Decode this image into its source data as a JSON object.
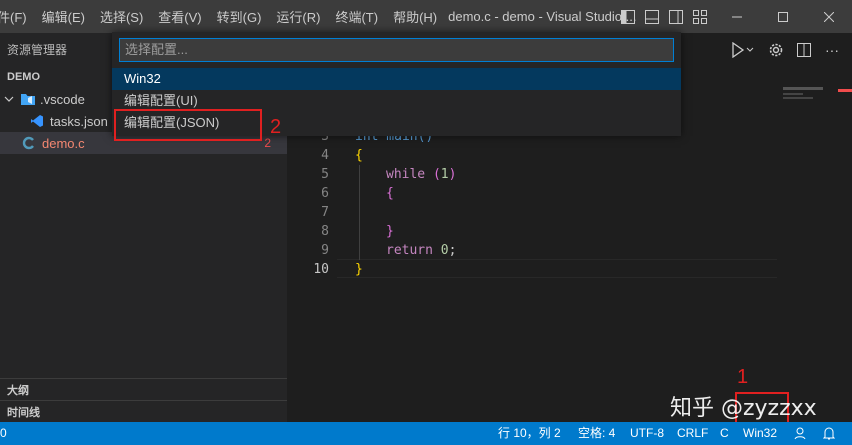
{
  "titlebar": {
    "menus": [
      "件(F)",
      "编辑(E)",
      "选择(S)",
      "查看(V)",
      "转到(G)",
      "运行(R)",
      "终端(T)",
      "帮助(H)"
    ],
    "title": "demo.c - demo - Visual Studio ...",
    "controls": [
      "minimize-icon",
      "maximize-icon",
      "close-icon"
    ]
  },
  "sidebar": {
    "header": "资源管理器",
    "section": "DEMO",
    "items": [
      {
        "label": ".vscode",
        "icon": "folder-vscode-icon"
      },
      {
        "label": "tasks.json",
        "icon": "vscode-json-icon"
      },
      {
        "label": "demo.c",
        "icon": "c-file-icon",
        "badge": "2"
      }
    ],
    "panels": [
      "大纲",
      "时间线"
    ]
  },
  "quickpick": {
    "placeholder": "选择配置...",
    "items": [
      "Win32",
      "编辑配置(UI)",
      "编辑配置(JSON)"
    ]
  },
  "editor": {
    "lines": [
      {
        "n": "3",
        "text": "int main()"
      },
      {
        "n": "4",
        "text": "{"
      },
      {
        "n": "5",
        "text": "while (1)"
      },
      {
        "n": "6",
        "text": "{"
      },
      {
        "n": "7",
        "text": ""
      },
      {
        "n": "8",
        "text": "}"
      },
      {
        "n": "9",
        "text": "return 0;"
      },
      {
        "n": "10",
        "text": "}"
      }
    ]
  },
  "annotations": {
    "one": "1",
    "two": "2"
  },
  "statusbar": {
    "left": "0",
    "position": "行 10，列 2",
    "spaces": "空格: 4",
    "encoding": "UTF-8",
    "eol": "CRLF",
    "language": "C",
    "config": "Win32"
  },
  "watermark": "知乎 @zyzzxx",
  "colors": {
    "accent": "#007acc",
    "annotation_red": "#e02020",
    "selection": "#04395e"
  }
}
